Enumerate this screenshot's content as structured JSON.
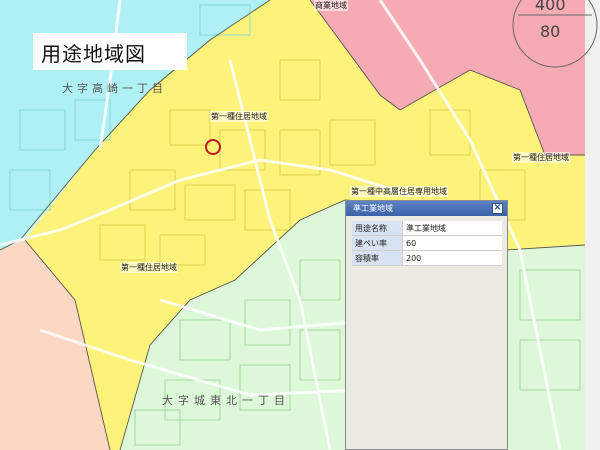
{
  "title": "用途地域図",
  "area_labels": [
    "大字高崎一丁目",
    "大字城東北一丁目"
  ],
  "zone_labels": [
    "第一種住居地域",
    "第一種住居地域",
    "第一種中高層住居専用地域",
    "第一種住居地域",
    "商業地域"
  ],
  "legend_numbers": [
    "400",
    "80"
  ],
  "popup": {
    "header": "準工業地域",
    "rows": [
      {
        "key": "用途名称",
        "value": "準工業地域"
      },
      {
        "key": "建ぺい率",
        "value": "60"
      },
      {
        "key": "容積率",
        "value": "200"
      }
    ]
  },
  "colors": {
    "yellow_zone": "#fdf27a",
    "cyan_zone": "#aef0f4",
    "pink_zone": "#f4a9b3",
    "green_zone": "#d9f7d6",
    "peach_zone": "#fbd8c4",
    "marker": "#c0181f"
  }
}
